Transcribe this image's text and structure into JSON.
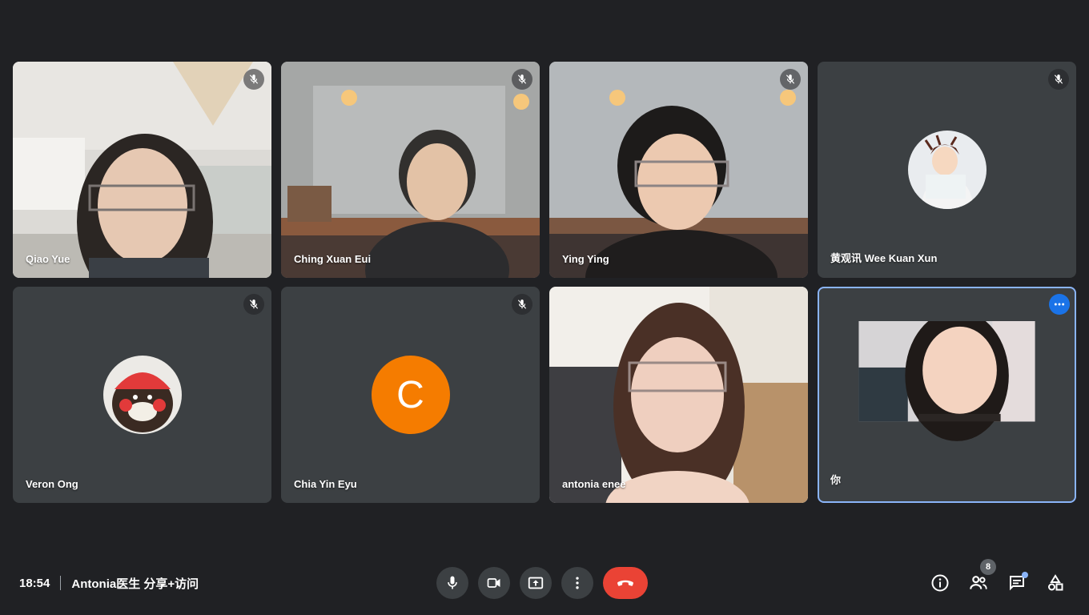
{
  "participants": [
    {
      "name": "Qiao Yue"
    },
    {
      "name": "Ching Xuan Eui"
    },
    {
      "name": "Ying Ying"
    },
    {
      "name": "黄观讯 Wee Kuan Xun"
    },
    {
      "name": "Veron Ong"
    },
    {
      "name": "Chia Yin Eyu",
      "avatar_letter": "C"
    },
    {
      "name": "antonia enee"
    },
    {
      "name": "你"
    }
  ],
  "footer": {
    "time": "18:54",
    "meeting_title": "Antonia医生 分享+访问",
    "people_count": "8"
  },
  "icons": {
    "mic_off": "mic-off-icon",
    "mic": "mic-icon",
    "camera": "videocam-icon",
    "present": "present-screen-icon",
    "more": "more-vert-icon",
    "end_call": "call-end-icon",
    "info": "info-icon",
    "people": "people-icon",
    "chat": "chat-icon",
    "activities": "activities-icon"
  },
  "colors": {
    "background": "#202124",
    "tile": "#3c4043",
    "end_call": "#ea4335",
    "self_border": "#8ab4f8",
    "letter_avatar": "#f57c00",
    "accent": "#1a73e8"
  }
}
